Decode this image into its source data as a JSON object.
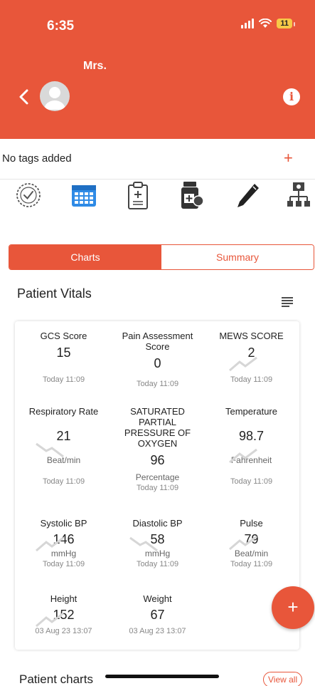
{
  "status_bar": {
    "time": "6:35",
    "battery": "11"
  },
  "header": {
    "patient_name": "Mrs.",
    "info_label": "i"
  },
  "tags": {
    "text": "No tags added",
    "add_label": "+"
  },
  "toolbar_icons": [
    "clock-check-icon",
    "calendar-icon",
    "clipboard-icon",
    "medicine-icon",
    "pen-icon",
    "org-chart-icon"
  ],
  "tabs": [
    {
      "label": "Charts",
      "active": true
    },
    {
      "label": "Summary",
      "active": false
    }
  ],
  "vitals": {
    "title": "Patient Vitals",
    "items": [
      {
        "name": "GCS Score",
        "value": "15",
        "unit": "",
        "time": "Today 11:09"
      },
      {
        "name": "Pain Assessment Score",
        "value": "0",
        "unit": "",
        "time": "Today 11:09"
      },
      {
        "name": "MEWS SCORE",
        "value": "2",
        "unit": "",
        "time": "Today 11:09"
      },
      {
        "name": "Respiratory Rate",
        "value": "21",
        "unit": "Beat/min",
        "time": "Today 11:09"
      },
      {
        "name": "SATURATED PARTIAL PRESSURE OF OXYGEN",
        "value": "96",
        "unit": "Percentage",
        "time": "Today 11:09"
      },
      {
        "name": "Temperature",
        "value": "98.7",
        "unit": "Fahrenheit",
        "time": "Today 11:09"
      },
      {
        "name": "Systolic BP",
        "value": "146",
        "unit": "mmHg",
        "time": "Today 11:09"
      },
      {
        "name": "Diastolic BP",
        "value": "58",
        "unit": "mmHg",
        "time": "Today 11:09"
      },
      {
        "name": "Pulse",
        "value": "79",
        "unit": "Beat/min",
        "time": "Today 11:09"
      },
      {
        "name": "Height",
        "value": "152",
        "unit": "",
        "time": "03 Aug 23 13:07"
      },
      {
        "name": "Weight",
        "value": "67",
        "unit": "",
        "time": "03 Aug 23 13:07"
      }
    ]
  },
  "fab": {
    "label": "+"
  },
  "patient_charts": {
    "title": "Patient charts",
    "view_all": "View all"
  },
  "colors": {
    "accent": "#e8563a",
    "card_bg": "#ffffff",
    "trend_line": "#d0d0d0"
  }
}
